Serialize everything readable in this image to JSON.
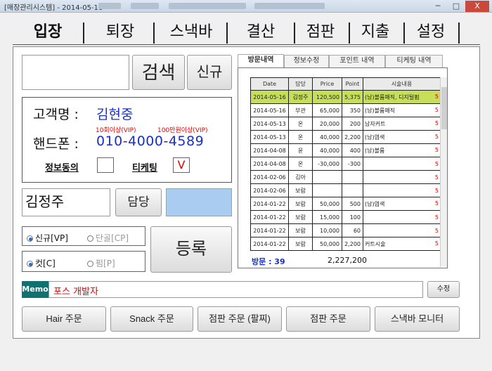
{
  "window": {
    "title": "[매장관리시스템] - 2014-05-16",
    "minimize": "─",
    "maximize": "□",
    "close": "X"
  },
  "tabs": [
    "입장",
    "퇴장",
    "스낵바",
    "결산",
    "점판",
    "지출",
    "설정"
  ],
  "search": {
    "value": "",
    "search_label": "검색",
    "new_label": "신규"
  },
  "customer": {
    "name_label": "고객명 :",
    "name": "김현중",
    "vip_visits": "10회이상(VIP)",
    "vip_amount": "100만원이상(VIP)",
    "phone_label": "핸드폰 :",
    "phone": "010-4000-4589",
    "agree_label": "정보동의",
    "agree_value": "",
    "ticketing_label": "티케팅",
    "ticketing_value": "V"
  },
  "staff": {
    "name": "김정주",
    "button_label": "담당"
  },
  "type_radios": [
    {
      "label": "신규[VP]",
      "checked": true
    },
    {
      "label": "단골[CP]",
      "checked": false
    }
  ],
  "service_radios": [
    {
      "label": "컷[C]",
      "checked": true
    },
    {
      "label": "펌[P]",
      "checked": false
    }
  ],
  "register_label": "등록",
  "visit_tabs": [
    "방문내역",
    "정보수정",
    "포인트 내역",
    "티케팅 내역"
  ],
  "visit_table": {
    "headers": [
      "Date",
      "담당",
      "Price",
      "Point",
      "시술내용"
    ],
    "rows": [
      [
        "2014-05-16",
        "김정주",
        "120,500",
        "5,375",
        "(남)볼륨매직, 디지털펌",
        "5"
      ],
      [
        "2014-05-16",
        "부관",
        "65,000",
        "350",
        "(남)볼륨매직",
        "5"
      ],
      [
        "2014-05-13",
        "온",
        "20,000",
        "200",
        "남자커트",
        "5"
      ],
      [
        "2014-05-13",
        "온",
        "40,000",
        "2,200",
        "(남)염색",
        "5"
      ],
      [
        "2014-04-08",
        "윤",
        "40,000",
        "400",
        "(남)볼륨",
        "5"
      ],
      [
        "2014-04-08",
        "온",
        "-30,000",
        "-300",
        "",
        "5"
      ],
      [
        "2014-02-06",
        "김아",
        "",
        "",
        "",
        "5"
      ],
      [
        "2014-02-06",
        "보람",
        "",
        "",
        "",
        "5"
      ],
      [
        "2014-01-22",
        "보람",
        "50,000",
        "500",
        "(남)염색",
        "5"
      ],
      [
        "2014-01-22",
        "보람",
        "15,000",
        "100",
        "",
        "5"
      ],
      [
        "2014-01-22",
        "보람",
        "10,000",
        "60",
        "",
        "5"
      ],
      [
        "2014-01-22",
        "보람",
        "50,000",
        "2,200",
        "커트시술",
        "5"
      ]
    ]
  },
  "visit_summary": {
    "count": "방문 : 39",
    "total": "2,227,200"
  },
  "memo": {
    "label": "Memo",
    "value": "포스 개발자",
    "edit_label": "수정"
  },
  "bottom_buttons": [
    "Hair 주문",
    "Snack 주문",
    "점판 주문 (팔찌)",
    "점판 주문",
    "스낵바 모니터"
  ],
  "colors": {
    "accent_blue": "#1930c8",
    "vip_red": "#e00000",
    "memo_teal": "#117070",
    "selected_row": "#c7de5a",
    "staff_color": "#a9ccf0"
  }
}
